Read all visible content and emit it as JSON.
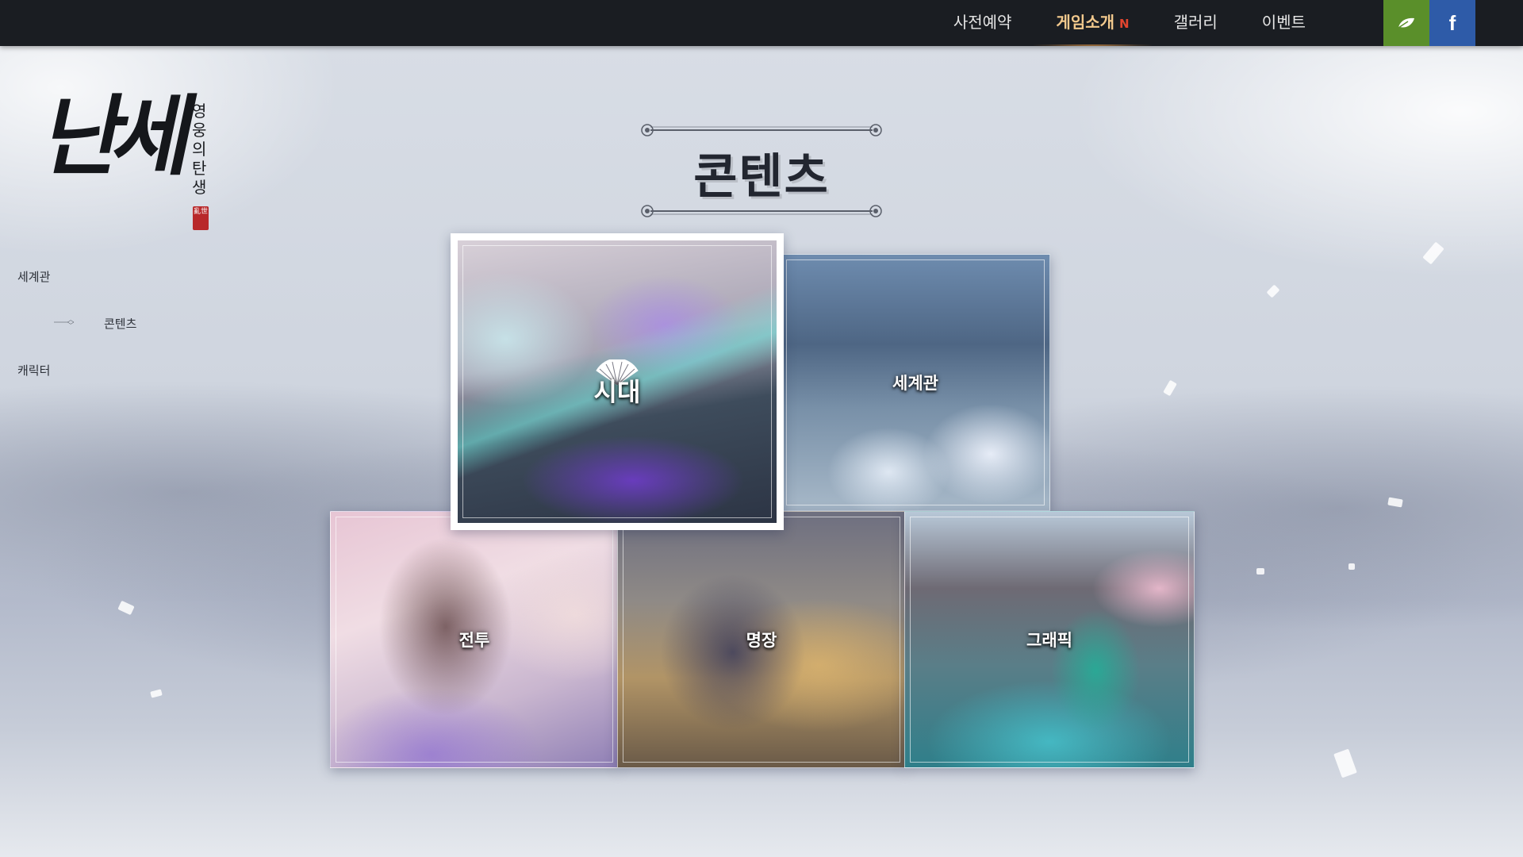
{
  "nav": {
    "items": [
      {
        "label": "사전예약"
      },
      {
        "label": "게임소개",
        "badge": "N"
      },
      {
        "label": "갤러리"
      },
      {
        "label": "이벤트"
      }
    ],
    "active_index": 1,
    "sns": [
      {
        "icon": "leaf-icon",
        "color": "#5a8f2a"
      },
      {
        "icon": "facebook-icon",
        "label": "f",
        "color": "#2e5ba8"
      }
    ]
  },
  "logo": {
    "main": "난세",
    "subtitle": "영웅의탄생",
    "seal": "亂世"
  },
  "sidenav": {
    "items": [
      {
        "label": "세계관"
      },
      {
        "label": "콘텐츠"
      },
      {
        "label": "캐릭터"
      }
    ],
    "active_index": 1
  },
  "section": {
    "title": "콘텐츠"
  },
  "tiles": {
    "featured": {
      "label": "시대",
      "icon": "fan-icon"
    },
    "segyegwan": {
      "label": "세계관"
    },
    "jeontu": {
      "label": "전투"
    },
    "myeongjang": {
      "label": "명장"
    },
    "graphic": {
      "label": "그래픽"
    }
  },
  "colors": {
    "nav_bg": "#1a1d22",
    "nav_active": "#f2c98d",
    "badge": "#e2452f"
  }
}
